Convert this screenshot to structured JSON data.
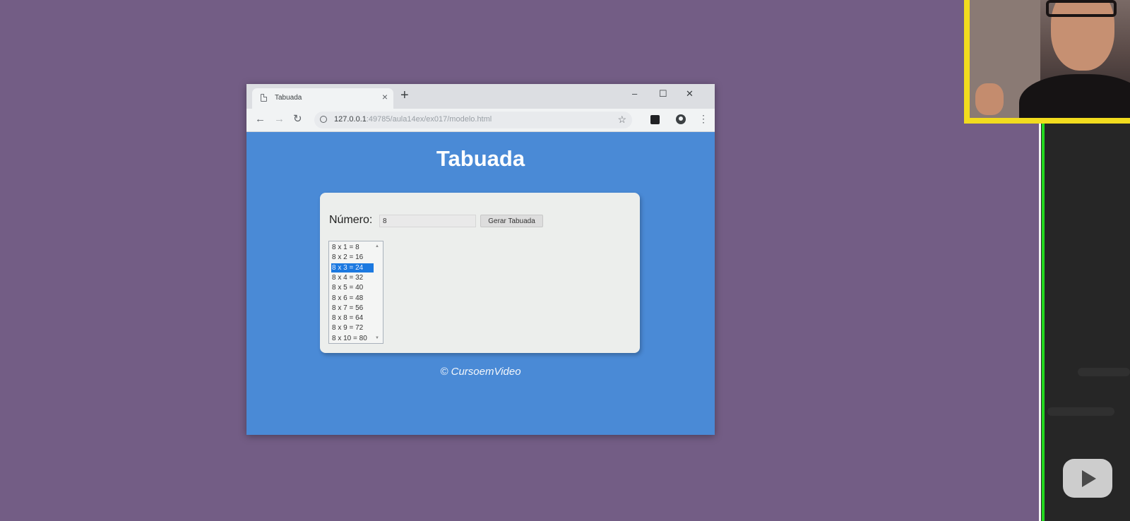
{
  "browser": {
    "tab_title": "Tabuada",
    "tab_close": "×",
    "new_tab": "+",
    "window_controls": [
      "–",
      "☐",
      "✕"
    ],
    "nav": {
      "back": "←",
      "forward": "→",
      "reload": "↻"
    },
    "url_host": "127.0.0.1",
    "url_rest": ":49785/aula14ex/ex017/modelo.html",
    "star": "☆",
    "menu": "⋮"
  },
  "page": {
    "title": "Tabuada",
    "number_label": "Número:",
    "number_value": "8",
    "generate_button": "Gerar Tabuada",
    "table": {
      "options": [
        "8 x 1 = 8",
        "8 x 2 = 16",
        "8 x 3 = 24",
        "8 x 4 = 32",
        "8 x 5 = 40",
        "8 x 6 = 48",
        "8 x 7 = 56",
        "8 x 8 = 64",
        "8 x 9 = 72",
        "8 x 10 = 80"
      ],
      "selected_index": 2
    },
    "footer": "© CursoemVideo"
  },
  "colors": {
    "backdrop": "#735d85",
    "page_background": "#4a8ad6",
    "card_background": "#eceeec",
    "selection": "#1c79e0",
    "webcam_border": "#f2dc1e"
  },
  "icons": [
    "document-icon",
    "info-icon",
    "star-icon",
    "extension-icon",
    "profile-icon",
    "menu-icon",
    "play-logo-icon"
  ]
}
